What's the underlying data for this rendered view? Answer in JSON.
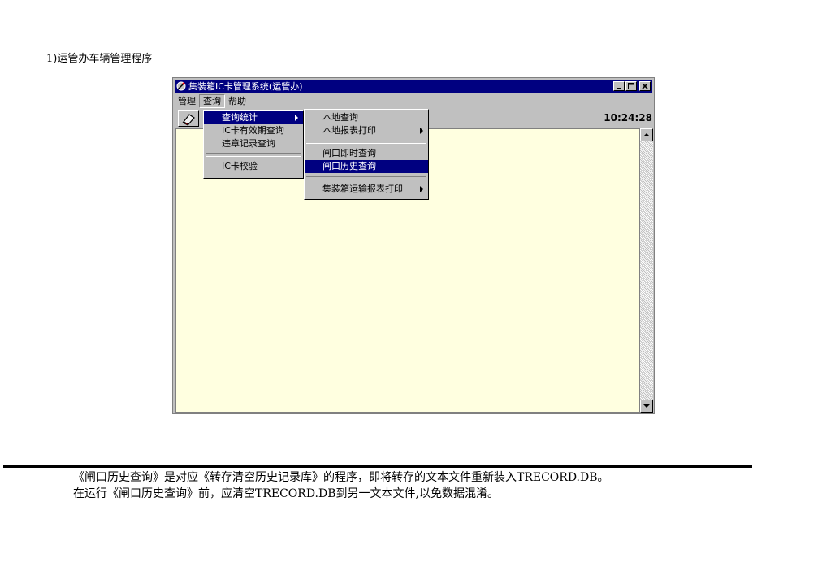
{
  "heading": "1)运管办车辆管理程序",
  "window": {
    "title": "集装箱IC卡管理系统(运管办)",
    "icons": {
      "app": "satellite-dish-icon",
      "minimize": "minimize-icon",
      "maximize": "maximize-icon",
      "close": "close-icon"
    },
    "menubar": [
      "管理",
      "查询",
      "帮助"
    ],
    "toolbar": {
      "button_icon": "eraser-icon",
      "clock": "10:24:28"
    },
    "colors": {
      "titlebar": "#000080",
      "client": "#ffffe0",
      "selection": "#000080"
    }
  },
  "query_menu": {
    "items": [
      "查询统计",
      "IC卡有效期查询",
      "违章记录查询",
      "IC卡校验"
    ],
    "selected": "查询统计"
  },
  "submenu": {
    "items": [
      "本地查询",
      "本地报表打印",
      "闸口即时查询",
      "闸口历史查询",
      "集装箱运输报表打印"
    ],
    "selected": "闸口历史查询"
  },
  "description": {
    "line1": "《闸口历史查询》是对应《转存清空历史记录库》的程序，即将转存的文本文件重新装入TRECORD.DB。",
    "line2": "在运行《闸口历史查询》前，应清空TRECORD.DB到另一文本文件,以免数据混淆。"
  }
}
